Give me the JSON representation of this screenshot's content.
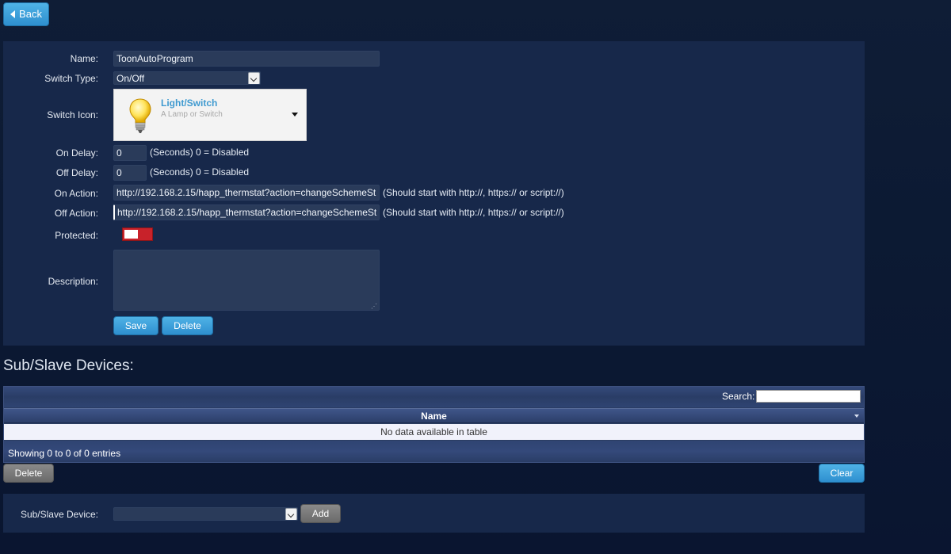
{
  "nav": {
    "back_label": "Back"
  },
  "form": {
    "name_label": "Name:",
    "name_value": "ToonAutoProgram",
    "switch_type_label": "Switch Type:",
    "switch_type_value": "On/Off",
    "switch_icon_label": "Switch Icon:",
    "icon_title": "Light/Switch",
    "icon_subtitle": "A Lamp or Switch",
    "on_delay_label": "On Delay:",
    "on_delay_value": "0",
    "on_delay_hint": "(Seconds) 0 = Disabled",
    "off_delay_label": "Off Delay:",
    "off_delay_value": "0",
    "off_delay_hint": "(Seconds) 0 = Disabled",
    "on_action_label": "On Action:",
    "on_action_value": "http://192.168.2.15/happ_thermstat?action=changeSchemeSt",
    "on_action_hint": "(Should start with http://, https:// or script://)",
    "off_action_label": "Off Action:",
    "off_action_value": "http://192.168.2.15/happ_thermstat?action=changeSchemeSt",
    "off_action_hint": "(Should start with http://, https:// or script://)",
    "protected_label": "Protected:",
    "description_label": "Description:",
    "description_value": "",
    "save_label": "Save",
    "delete_label": "Delete"
  },
  "sub_devices": {
    "heading": "Sub/Slave Devices:",
    "search_label": "Search:",
    "search_value": "",
    "column_name": "Name",
    "empty_text": "No data available in table",
    "info_text": "Showing 0 to 0 of 0 entries",
    "delete_label": "Delete",
    "clear_label": "Clear",
    "device_label": "Sub/Slave Device:",
    "device_value": "",
    "add_label": "Add"
  },
  "colors": {
    "accent": "#3a9fdb",
    "toggle_off": "#c8222a",
    "panel": "#17284a"
  }
}
